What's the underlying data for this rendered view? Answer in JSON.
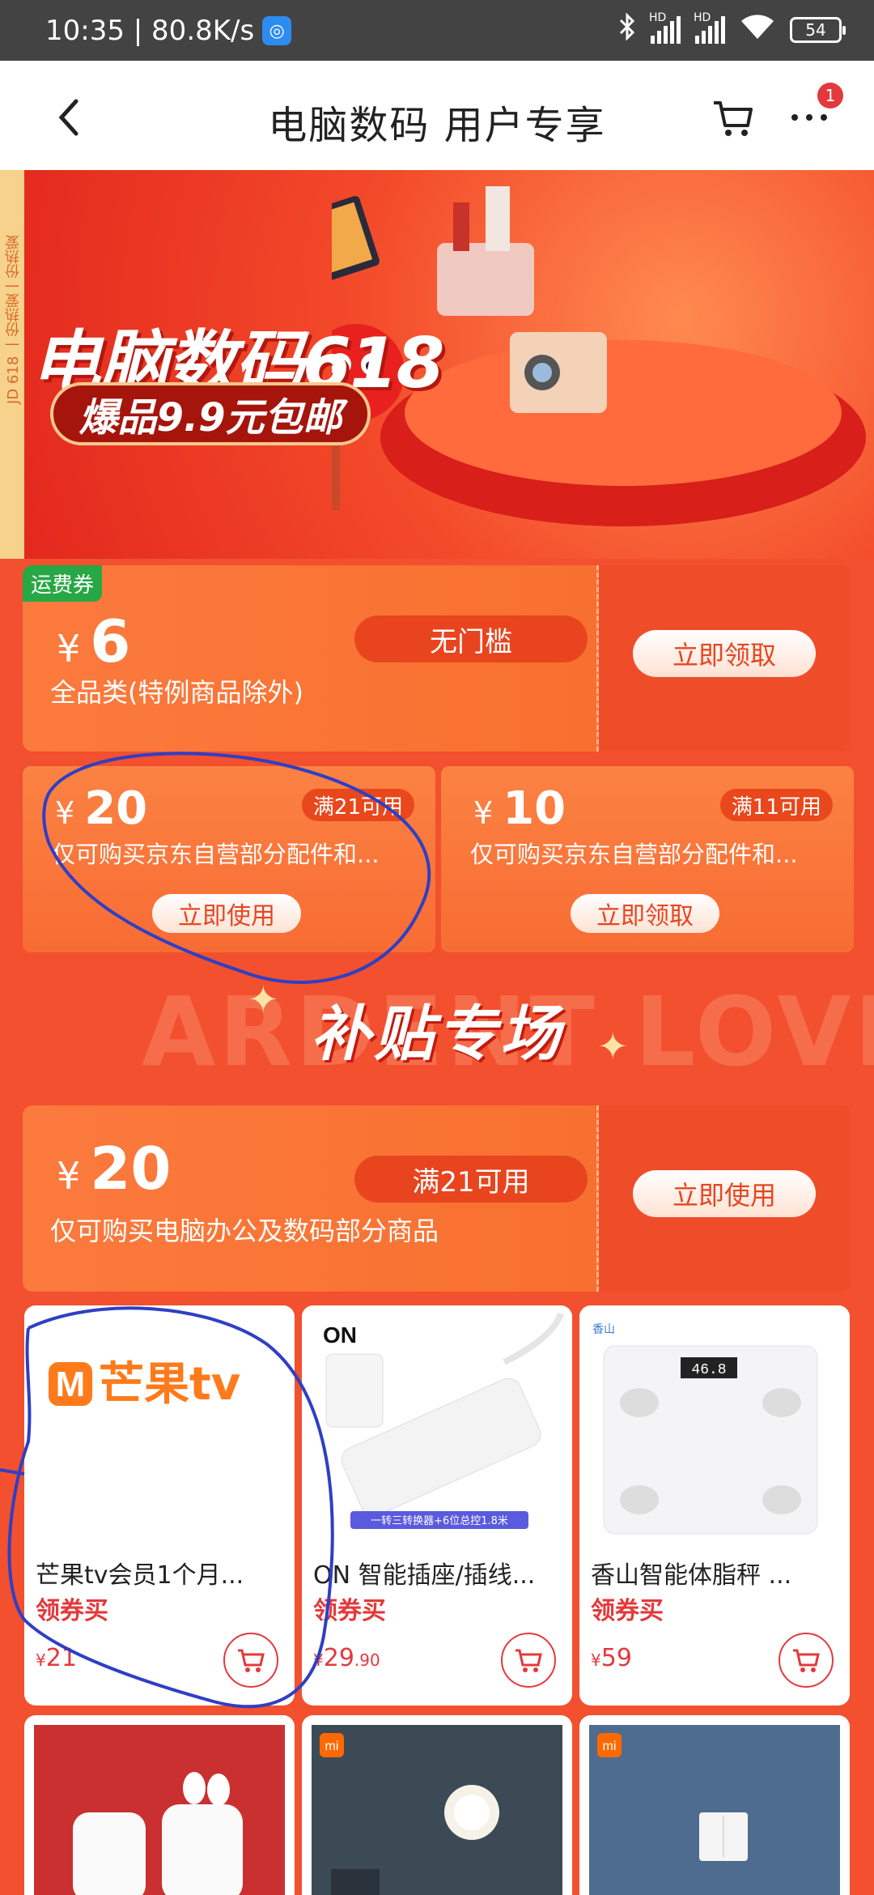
{
  "status_bar": {
    "time_speed": "10:35 | 80.8K/s",
    "hd1": "HD",
    "hd2": "HD",
    "battery": "54"
  },
  "nav": {
    "title": "电脑数码 用户专享",
    "badge_count": "1"
  },
  "banner": {
    "title": "电脑数码618",
    "subtitle": "爆品9.9元包邮",
    "side_text": "JD 618 一份热爱一份热爱"
  },
  "shipping_coupon": {
    "tag": "运费券",
    "currency": "¥",
    "amount": "6",
    "threshold": "无门槛",
    "description": "全品类(特例商品除外)",
    "button": "立即领取"
  },
  "coupons": [
    {
      "currency": "¥",
      "amount": "20",
      "threshold": "满21可用",
      "description": "仅可购买京东自营部分配件和...",
      "button": "立即使用"
    },
    {
      "currency": "¥",
      "amount": "10",
      "threshold": "满11可用",
      "description": "仅可购买京东自营部分配件和...",
      "button": "立即领取"
    }
  ],
  "subsidy": {
    "title": "补贴专场",
    "background_text": "ARDENT LOVE"
  },
  "big_coupon": {
    "currency": "¥",
    "amount": "20",
    "threshold": "满21可用",
    "description": "仅可购买电脑办公及数码部分商品",
    "button": "立即使用"
  },
  "products": [
    {
      "name": "芒果tv会员1个月...",
      "tag": "领券买",
      "currency": "¥",
      "price_int": "21",
      "price_dec": "",
      "logo_text": "芒果tv",
      "logo_mark": "M"
    },
    {
      "name": "ON 智能插座/插线...",
      "tag": "领券买",
      "currency": "¥",
      "price_int": "29",
      "price_dec": ".90",
      "brand": "ON",
      "strip_caption": "一转三转换器+6位总控1.8米"
    },
    {
      "name": "香山智能体脂秤 ...",
      "tag": "领券买",
      "currency": "¥",
      "price_int": "59",
      "price_dec": "",
      "brand": "香山",
      "scale_display": "46.8"
    }
  ],
  "second_row": [
    {
      "image": "earbuds"
    },
    {
      "image": "night-light",
      "brand": "mi"
    },
    {
      "image": "wall-switch",
      "brand": "mi"
    }
  ],
  "colors": {
    "page_bg": "#f2502e",
    "accent_red": "#e4393c",
    "coupon_orange": "#f8702f",
    "annotation_blue": "#2f3fc4"
  }
}
